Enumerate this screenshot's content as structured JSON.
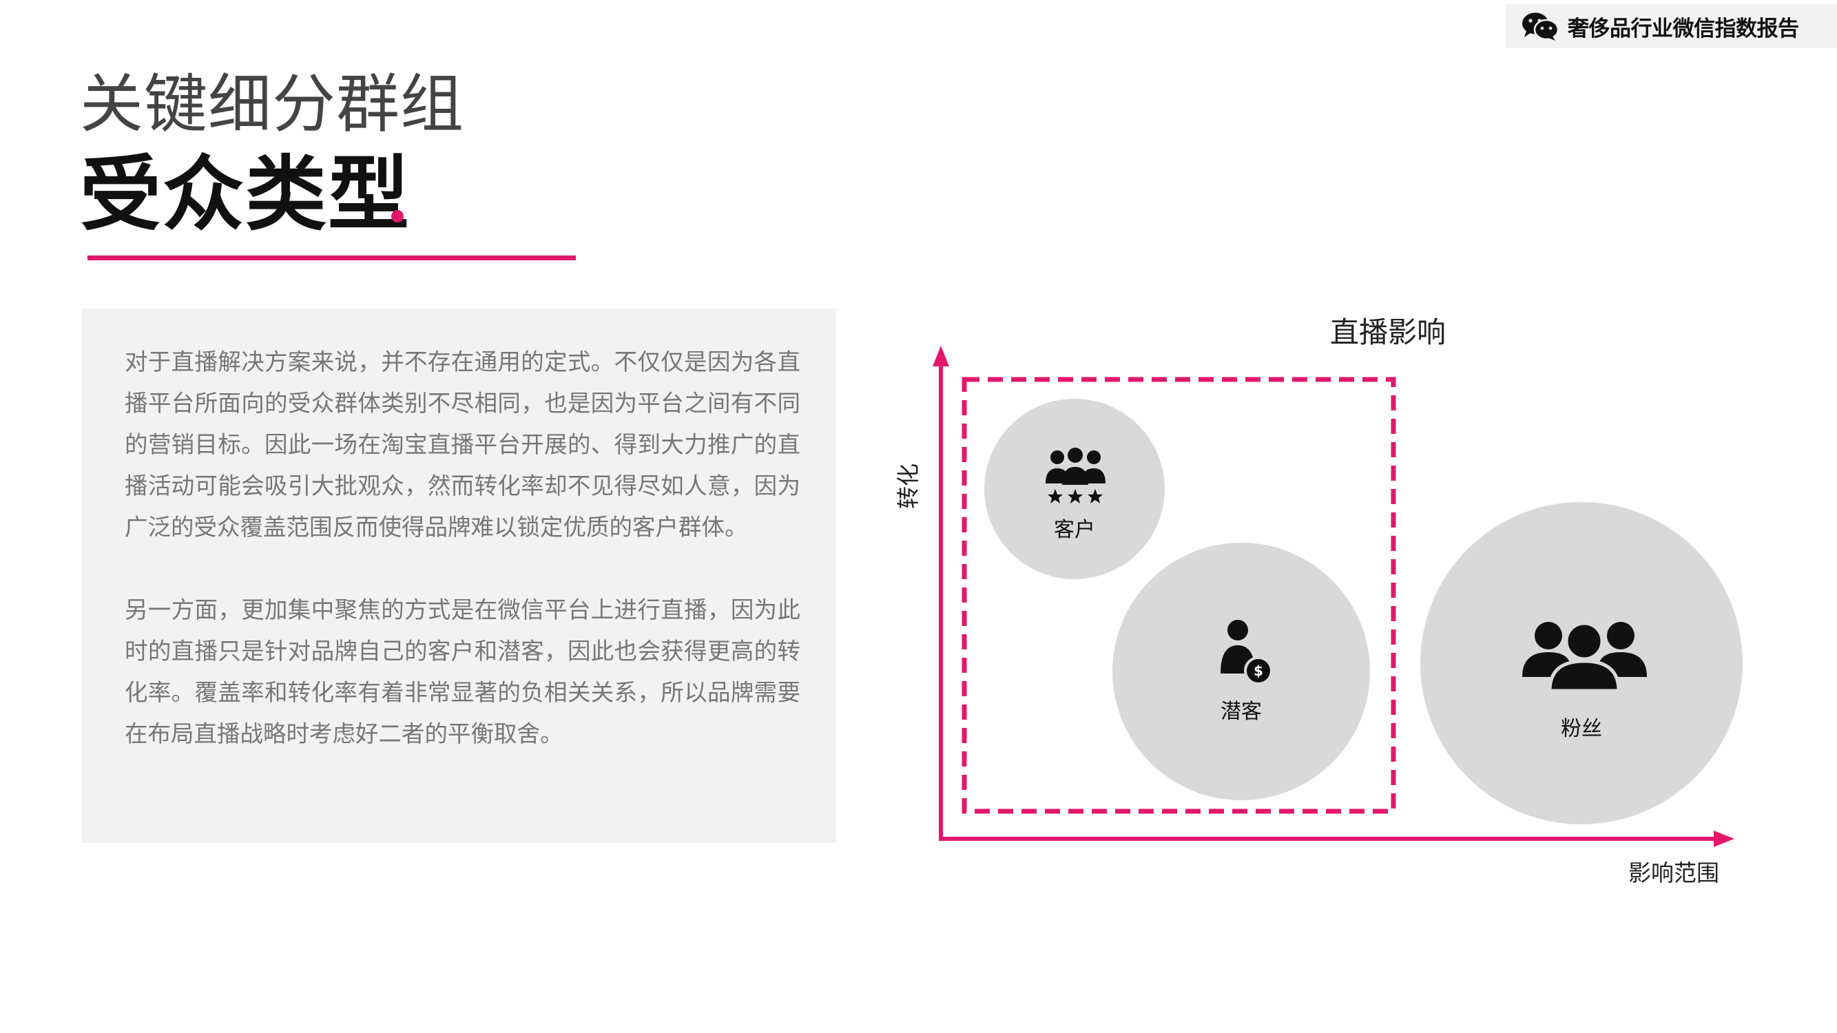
{
  "brand": {
    "name": "奢侈品行业微信指数报告",
    "icon": "wechat-icon"
  },
  "header": {
    "subtitle": "关键细分群组",
    "title": "受众类型"
  },
  "colors": {
    "accent": "#e0196b",
    "panel": "#f2f2f2",
    "bubble": "#d9d9d9"
  },
  "body": {
    "paragraph1": "对于直播解决方案来说，并不存在通用的定式。不仅仅是因为各直播平台所面向的受众群体类别不尽相同，也是因为平台之间有不同的营销目标。因此一场在淘宝直播平台开展的、得到大力推广的直播活动可能会吸引大批观众，然而转化率却不见得尽如人意，因为广泛的受众覆盖范围反而使得品牌难以锁定优质的客户群体。",
    "paragraph2": "另一方面，更加集中聚焦的方式是在微信平台上进行直播，因为此时的直播只是针对品牌自己的客户和潜客，因此也会获得更高的转化率。覆盖率和转化率有着非常显著的负相关关系，所以品牌需要在布局直播战略时考虑好二者的平衡取舍。"
  },
  "diagram": {
    "box_label": "直播影响",
    "y_axis_label": "转化",
    "x_axis_label": "影响范围",
    "nodes": [
      {
        "label": "客户",
        "icon": "customers-stars-icon"
      },
      {
        "label": "潜客",
        "icon": "person-dollar-icon"
      },
      {
        "label": "粉丝",
        "icon": "group-icon"
      }
    ]
  }
}
